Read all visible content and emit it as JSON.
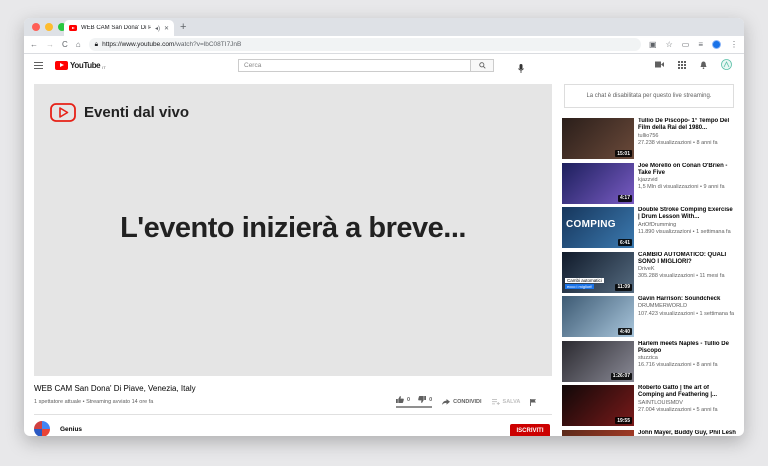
{
  "browser": {
    "tab_title": "WEB CAM San Dona' Di Pi",
    "url_prefix": "https://www.youtube.com",
    "url_rest": "/watch?v=lbC08TI7JnB",
    "nav": [
      "←",
      "→",
      "C",
      "⌂"
    ]
  },
  "header": {
    "logo_text": "YouTube",
    "logo_region": "IT",
    "search_placeholder": "Cerca"
  },
  "player": {
    "badge_label": "Eventi dal vivo",
    "message": "L'evento inizierà a breve..."
  },
  "video": {
    "title": "WEB CAM San Dona' Di Piave, Venezia, Italy",
    "meta": "1 spettatore attuale • Streaming avviato 14 ore fa",
    "likes": "0",
    "dislikes": "0",
    "share_label": "CONDIVIDI",
    "save_label": "SALVA"
  },
  "channel": {
    "name": "Genius",
    "subscribe_label": "ISCRIVITI"
  },
  "chat": {
    "disabled_message": "La chat è disabilitata per questo live streaming."
  },
  "recommendations": [
    {
      "title": "Tullio De Piscopo- 1° Tempo Del Film della Rai del 1980...",
      "channel": "tullio756",
      "stats": "27.238 visualizzazioni • 8 anni fa",
      "duration": "15:01",
      "thumb_colors": [
        "#2a1e1a",
        "#6b4a3a"
      ]
    },
    {
      "title": "Joe Morello on Conan O'Brien - Take Five",
      "channel": "kjazzvid",
      "stats": "1,5 Mln di visualizzazioni • 9 anni fa",
      "duration": "4:17",
      "thumb_colors": [
        "#1c1f5c",
        "#7a5cc4"
      ]
    },
    {
      "title": "Double Stroke Comping Exercise | Drum Lesson With...",
      "channel": "ArtOfDrumming",
      "stats": "11.890 visualizzazioni • 1 settimana fa",
      "duration": "6:41",
      "overlay": "COMPING",
      "thumb_colors": [
        "#16365c",
        "#3c7ab0"
      ]
    },
    {
      "title": "CAMBIO AUTOMATICO: QUALI SONO I MIGLIORI?",
      "channel": "DriveK",
      "stats": "305.288 visualizzazioni • 11 mesi fa",
      "duration": "11:09",
      "caption1": "Cambi automatici",
      "caption2": "ecco i migliori!",
      "thumb_colors": [
        "#101a2a",
        "#556b80"
      ]
    },
    {
      "title": "Gavin Harrison: Soundcheck",
      "channel": "DRUMMERWORLD",
      "stats": "107.423 visualizzazioni • 1 settimana fa",
      "duration": "4:40",
      "thumb_colors": [
        "#3d5a73",
        "#a9c6dc"
      ]
    },
    {
      "title": "Harlem meets Naples - Tullio De Piscopo",
      "channel": "stuzzica",
      "stats": "16.716 visualizzazioni • 8 anni fa",
      "duration": "1:26:07",
      "thumb_colors": [
        "#2b2a30",
        "#8a8a96"
      ]
    },
    {
      "title": "Roberto Gatto | the art of Comping and Feathering |...",
      "channel": "SAINTLOUISMDV",
      "stats": "27.004 visualizzazioni • 5 anni fa",
      "duration": "19:55",
      "thumb_colors": [
        "#100808",
        "#7a1a1a"
      ]
    },
    {
      "title": "John Mayer, Buddy Guy, Phil Lesh and Questlove - \"Hoochie",
      "channel": "",
      "stats": "",
      "duration": "",
      "thumb_colors": [
        "#5a2a1a",
        "#c0402a"
      ]
    }
  ]
}
